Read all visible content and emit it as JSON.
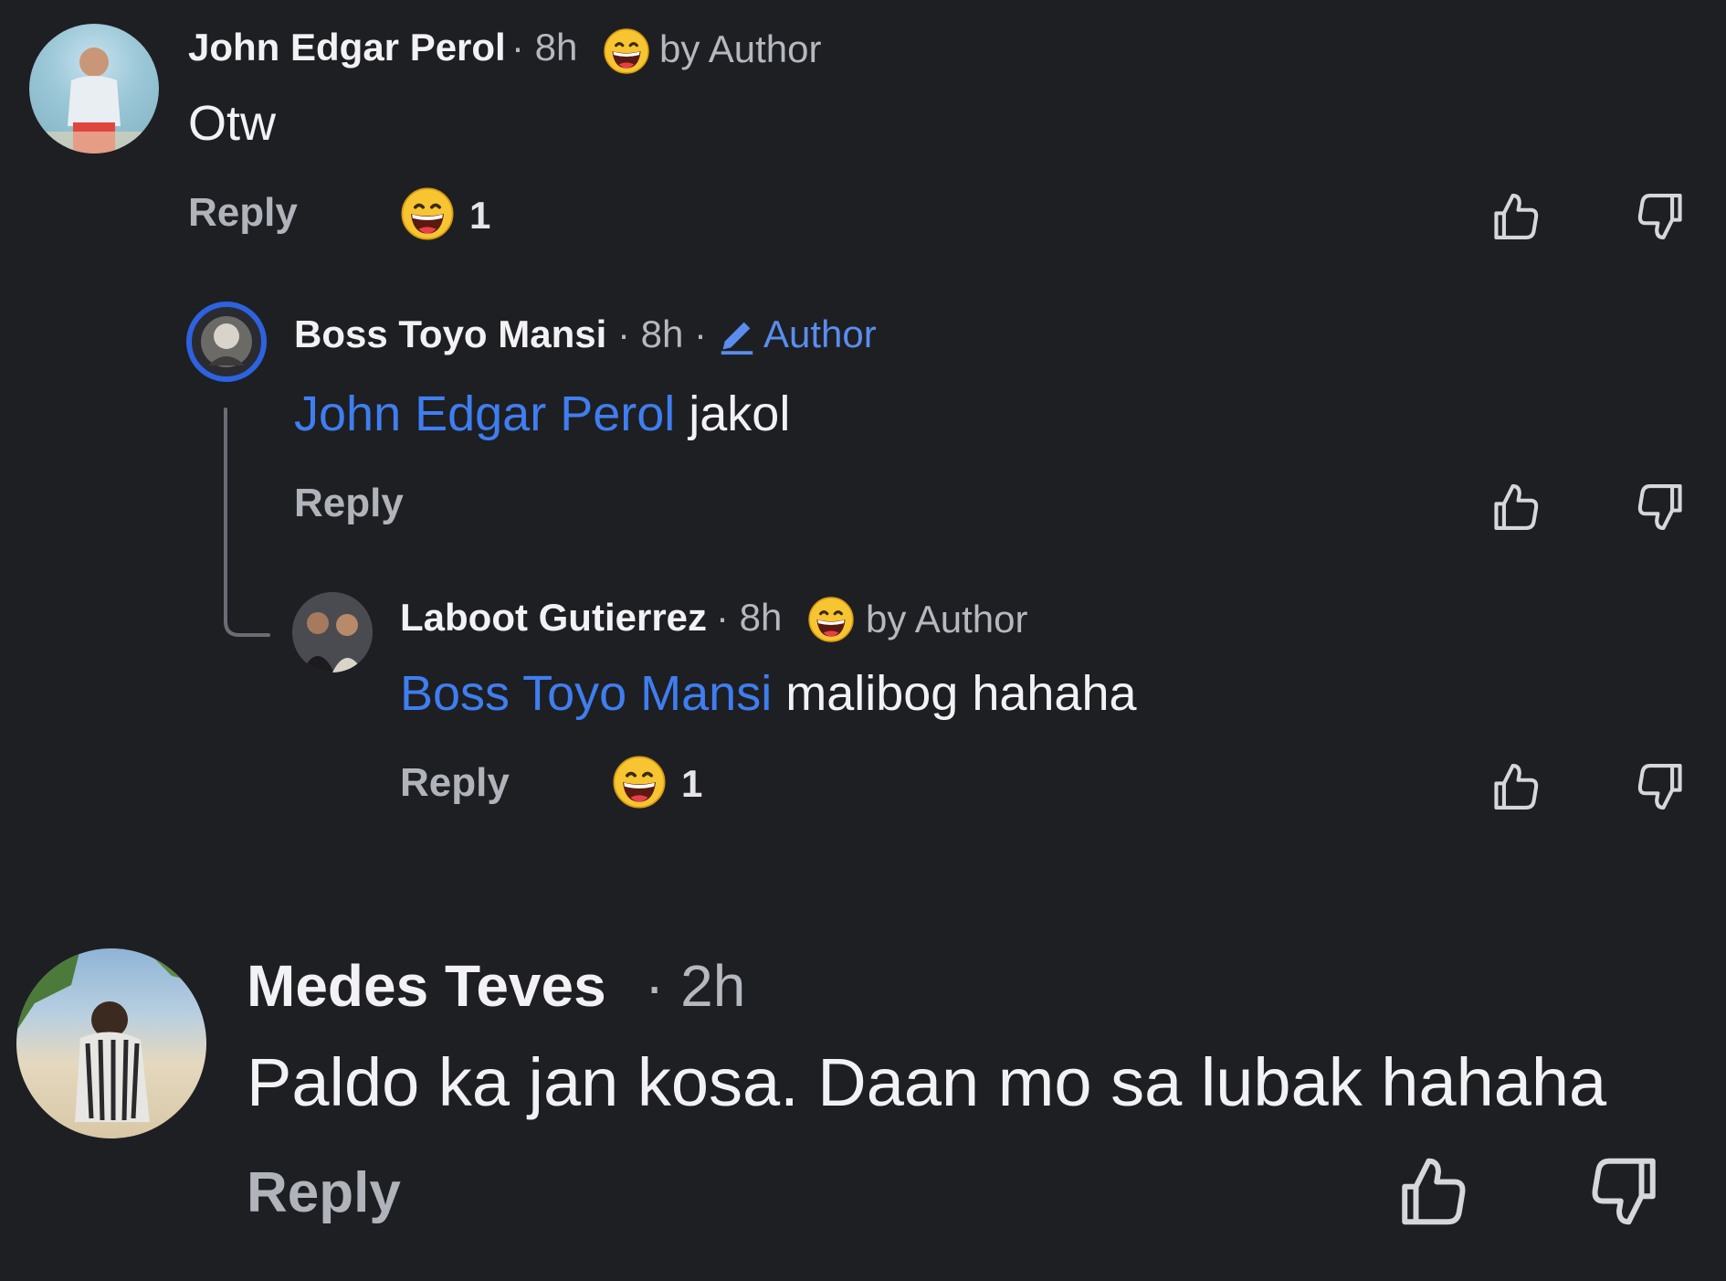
{
  "colors": {
    "background": "#1e1f23",
    "mention": "#3f7ef0",
    "author_badge": "#5a8dee",
    "emoji_face": "#f7c531"
  },
  "comments": [
    {
      "author": "John Edgar Perol",
      "time": "· 8h",
      "badge": "by Author",
      "badge_icon": "grin-emoji-icon",
      "text": "Otw",
      "reply_label": "Reply",
      "reaction_count": "1"
    },
    {
      "author": "Boss Toyo Mansi",
      "time": "· 8h ·",
      "badge": "Author",
      "badge_icon": "pencil-icon",
      "mention": "John Edgar Perol",
      "text": "jakol",
      "reply_label": "Reply"
    },
    {
      "author": "Laboot Gutierrez",
      "time": "· 8h",
      "badge": "by Author",
      "badge_icon": "grin-emoji-icon",
      "mention": "Boss Toyo Mansi",
      "text": "malibog hahaha",
      "reply_label": "Reply",
      "reaction_count": "1"
    },
    {
      "author": "Medes Teves",
      "time": "· 2h",
      "text": "Paldo ka jan kosa. Daan mo sa lubak hahaha",
      "reply_label": "Reply"
    }
  ]
}
